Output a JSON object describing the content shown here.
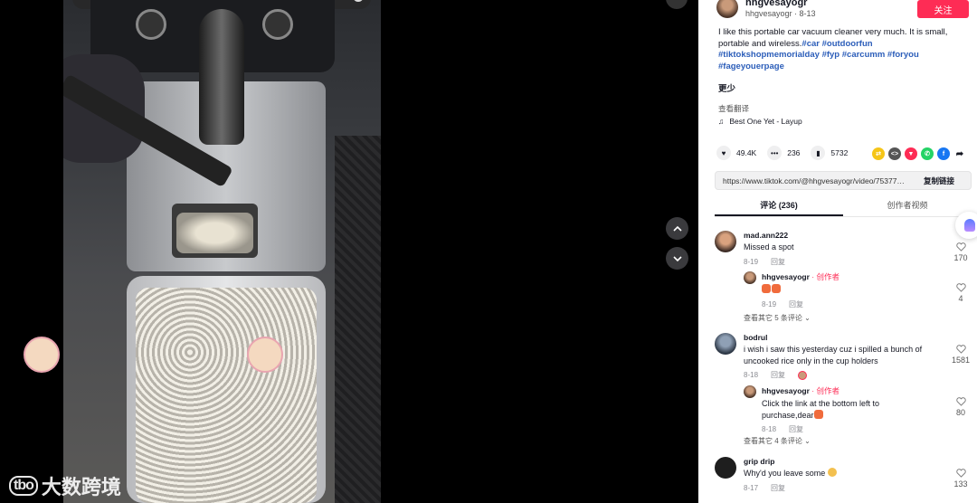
{
  "player": {
    "watermark_text": "大数跨境",
    "watermark_logo": "tbo"
  },
  "post": {
    "author_name": "hhgvesayogr",
    "author_handle": "hhgvesayogr",
    "author_date": "8-13",
    "follow_label": "关注",
    "description": "I like this portable car vacuum cleaner very much. It is small, portable and wireless.",
    "hashtags": [
      "#car",
      "#outdoorfun",
      "#tiktokshopmemorialday",
      "#fyp",
      "#carcumm",
      "#foryou",
      "#fageyouerpage"
    ],
    "more_label": "更少",
    "translate_label": "查看翻译",
    "music": "Best One Yet - Layup",
    "likes": "49.4K",
    "comments": "236",
    "saves": "5732",
    "link_url": "https://www.tiktok.com/@hhgvesayogr/video/7537749...",
    "copy_label": "复制链接"
  },
  "tabs": {
    "comments": "评论 (236)",
    "creator_videos": "创作者视频"
  },
  "comments": [
    {
      "name": "mad.ann222",
      "text": "Missed a spot",
      "date": "8-19",
      "reply_label": "回复",
      "likes": "170",
      "replies": [
        {
          "name": "hhgvesayogr",
          "creator_tag": "· 创作者",
          "date": "8-19",
          "reply_label": "回复",
          "likes": "4"
        }
      ],
      "view_more": "查看其它 5 条评论"
    },
    {
      "name": "bodrul",
      "text": "i wish i saw this yesterday cuz i spilled a bunch of uncooked rice only in the cup holders",
      "date": "8-18",
      "reply_label": "回复",
      "likes": "1581",
      "replies": [
        {
          "name": "hhgvesayogr",
          "creator_tag": "· 创作者",
          "text": "Click the link at the bottom left to purchase,dear",
          "date": "8-18",
          "reply_label": "回复",
          "likes": "80"
        }
      ],
      "view_more": "查看其它 4 条评论"
    },
    {
      "name": "grip drip",
      "text": "Why'd you leave some",
      "date": "8-17",
      "reply_label": "回复",
      "likes": "133"
    }
  ],
  "colors": {
    "brand_red": "#fe2c55",
    "hashtag_blue": "#2b5db9",
    "panel_bg": "#ffffff",
    "stage_bg": "#000000"
  },
  "icons": [
    "search-icon",
    "chevron-up-icon",
    "chevron-down-icon",
    "music-note-icon",
    "heart-icon",
    "comment-icon",
    "bookmark-icon",
    "share-icon"
  ]
}
